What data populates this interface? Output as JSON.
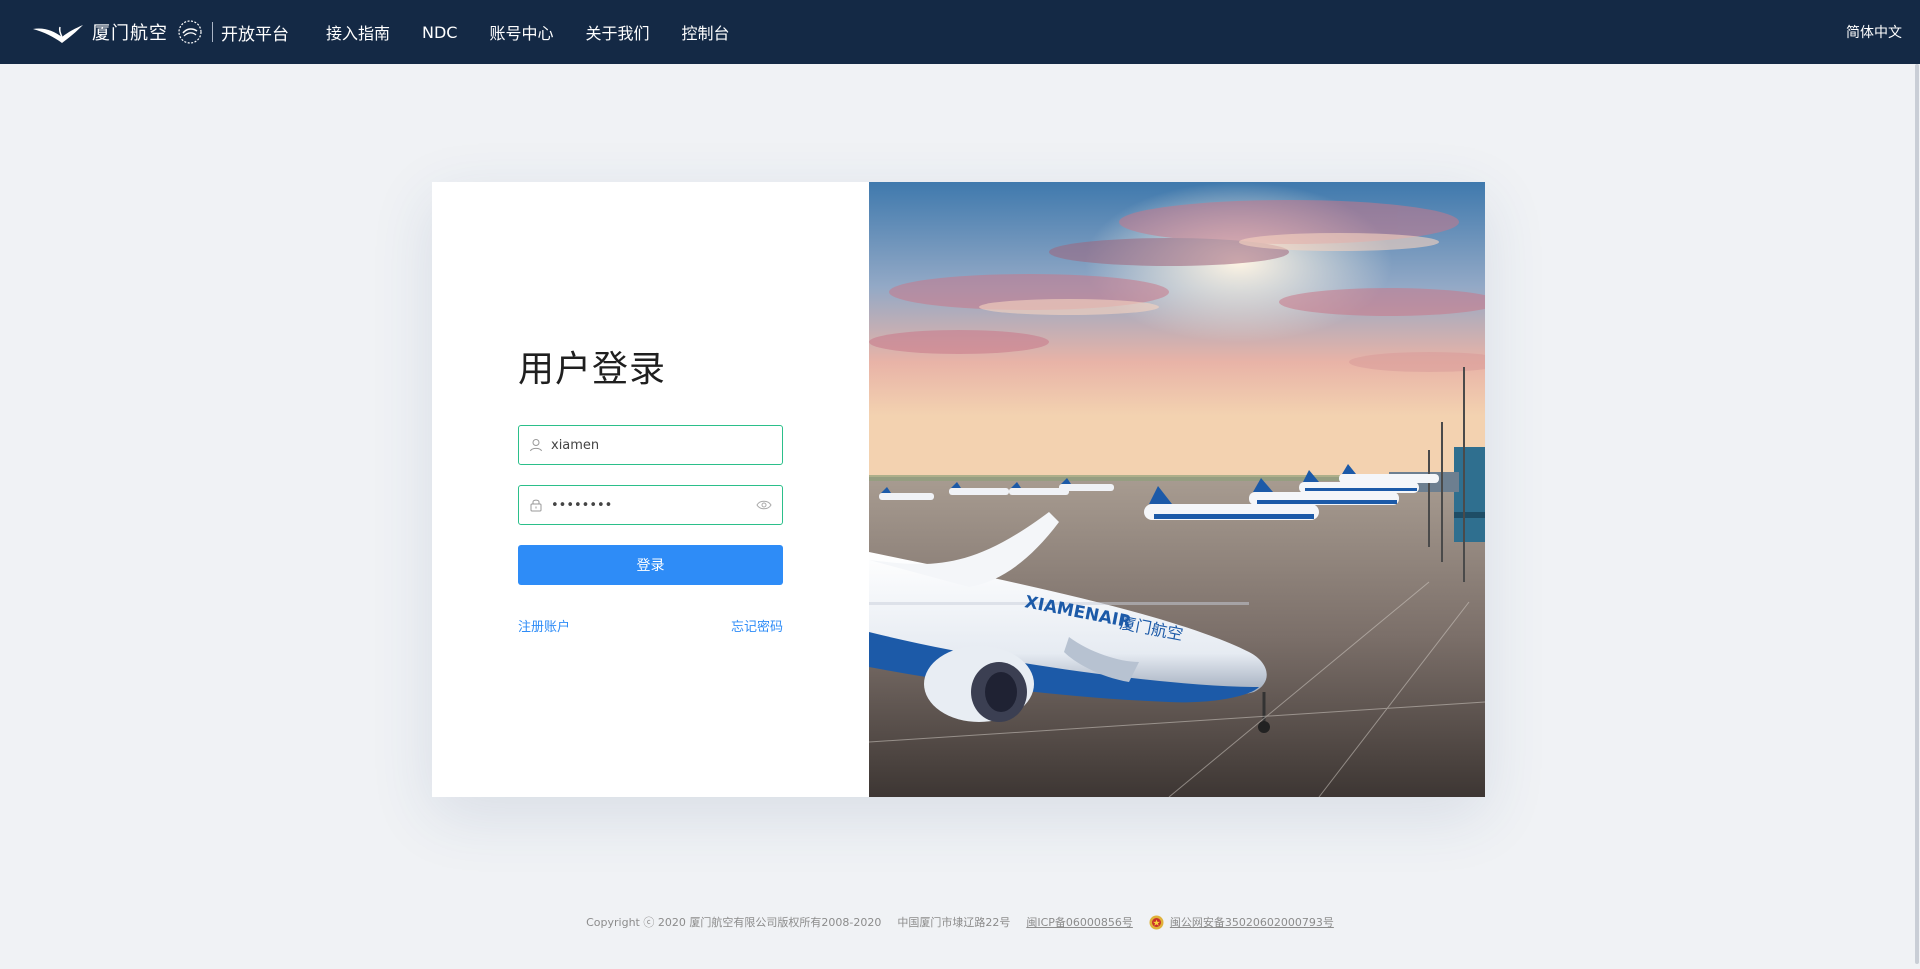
{
  "header": {
    "brand_name": "厦门航空",
    "brand_platform": "开放平台",
    "nav": [
      "接入指南",
      "NDC",
      "账号中心",
      "关于我们",
      "控制台"
    ],
    "language": "简体中文"
  },
  "login": {
    "title": "用户登录",
    "username_value": "xiamen",
    "password_value": "••••••••",
    "submit_label": "登录",
    "register_label": "注册账户",
    "forgot_label": "忘记密码"
  },
  "hero": {
    "plane_livery_text": "XIAMENAIR",
    "plane_livery_cn": "厦门航空"
  },
  "footer": {
    "copyright": "Copyright ⓒ 2020 厦门航空有限公司版权所有2008-2020",
    "address": "中国厦门市埭辽路22号",
    "icp": "闽ICP备06000856号",
    "police": "闽公网安备35020602000793号"
  },
  "icons": {
    "brand": "egret-bird-logo",
    "user": "user-icon",
    "lock": "lock-icon",
    "eye": "eye-icon",
    "police": "police-badge-icon"
  },
  "colors": {
    "header_bg": "#142945",
    "accent": "#2e8cf7",
    "field_border": "#2bbf8a",
    "page_bg": "#f0f2f5"
  }
}
